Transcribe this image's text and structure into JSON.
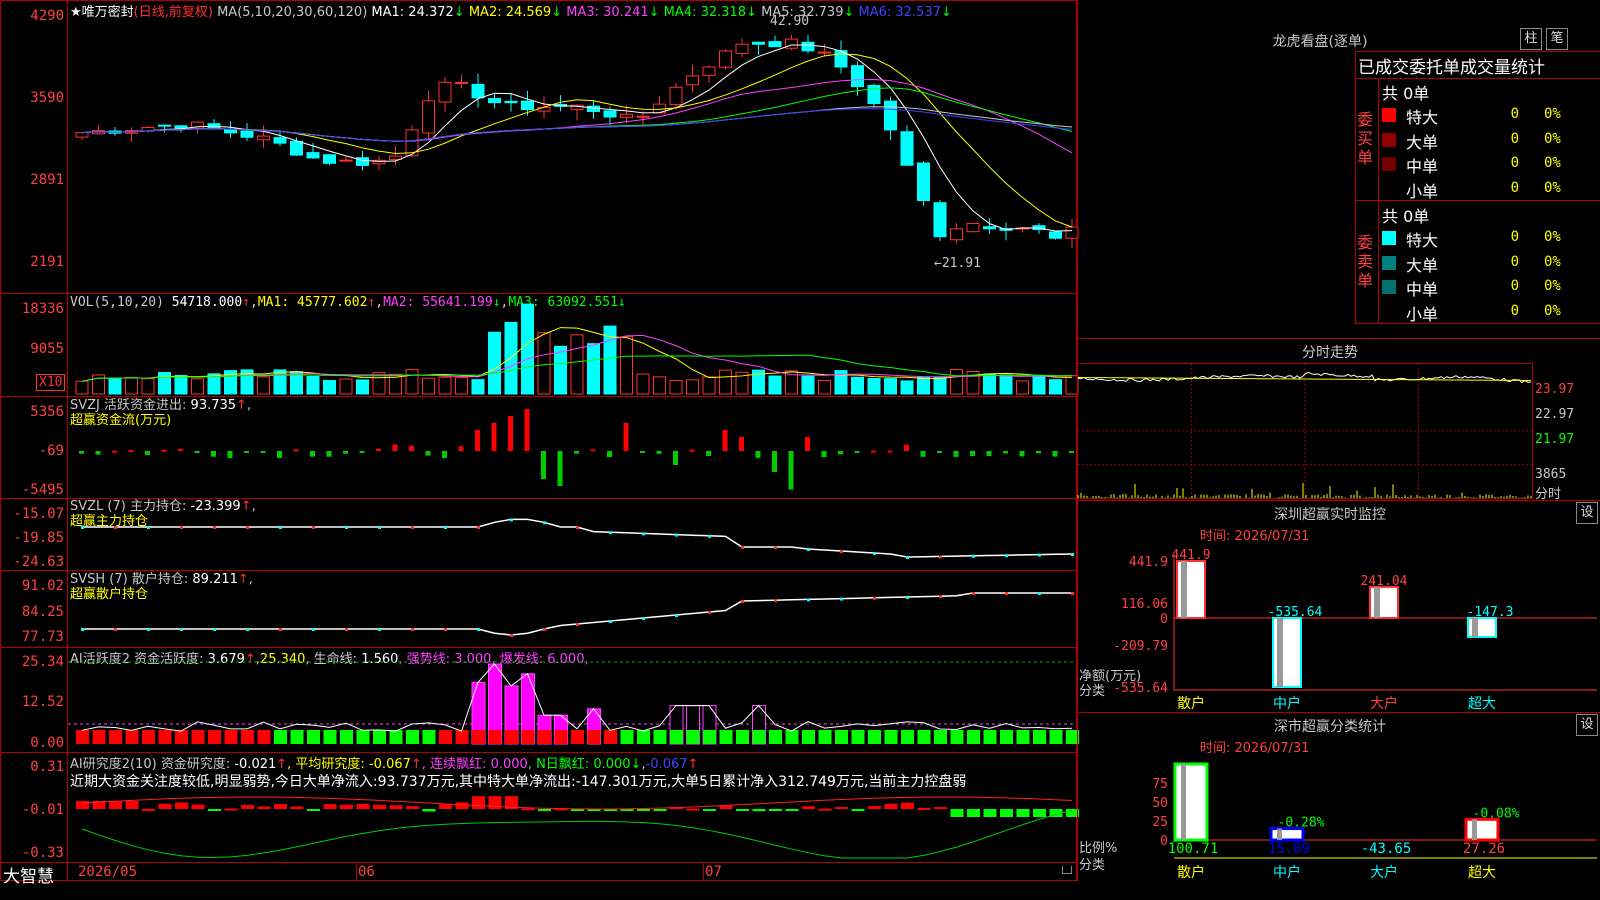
{
  "app": {
    "logo": "大智慧"
  },
  "main": {
    "star": "★",
    "stock_name": "唯万密封",
    "period": "(日线,前复权)",
    "ma_params": "MA(5,10,20,30,60,120)",
    "ma_items": [
      {
        "label": "MA1:",
        "value": "24.372",
        "arrow": "↓",
        "color": "#ffffff"
      },
      {
        "label": "MA2:",
        "value": "24.569",
        "arrow": "↓",
        "color": "#ffff00"
      },
      {
        "label": "MA3:",
        "value": "30.241",
        "arrow": "↓",
        "color": "#ff40ff"
      },
      {
        "label": "MA4:",
        "value": "32.318",
        "arrow": "↓",
        "color": "#00ff00"
      },
      {
        "label": "MA5:",
        "value": "32.739",
        "arrow": "↓",
        "color": "#c8c8c8"
      },
      {
        "label": "MA6:",
        "value": "32.537",
        "arrow": "↓",
        "color": "#4040ff"
      }
    ],
    "y_ticks": [
      "4290",
      "3590",
      "2891",
      "2191"
    ],
    "high_label": "42.90",
    "low_label": "←21.91"
  },
  "vol": {
    "params": "VOL(5,10,20)",
    "value": "54718.000",
    "arrow": "↑",
    "ma1": "MA1:",
    "ma1v": "45777.602",
    "ma1a": "↑",
    "ma2": "MA2:",
    "ma2v": "55641.199",
    "ma2a": "↓",
    "ma3": "MA3:",
    "ma3v": "63092.551",
    "ma3a": "↓",
    "y_ticks": [
      "18336",
      "9055"
    ],
    "unit": "X10"
  },
  "svzj": {
    "params": "SVZJ",
    "label": " 活跃资金进出:",
    "value": "93.735",
    "arrow": "↑",
    "comma": ",",
    "sub": "超赢资金流(万元)",
    "y_ticks": [
      "5356",
      "-69",
      "-5495"
    ]
  },
  "svzl": {
    "params": "SVZL (7)",
    "label": " 主力持仓:",
    "value": "-23.399",
    "arrow": "↑",
    "comma": ",",
    "sub": "超赢主力持仓",
    "y_ticks": [
      "-15.07",
      "-19.85",
      "-24.63"
    ]
  },
  "svsh": {
    "params": "SVSH (7)",
    "label": " 散户持仓:",
    "value": "89.211",
    "arrow": "↑",
    "comma": ",",
    "sub": "超赢散户持仓",
    "y_ticks": [
      "91.02",
      "84.25",
      "77.73"
    ]
  },
  "ai1": {
    "title": "AI活跃度2",
    "label": " 资金活跃度:",
    "value": "3.679",
    "a1": "↑",
    "v2": "25.340",
    "label3": ", 生命线:",
    "v3": "1.560",
    "label4": ", 强势线:",
    "v4": "3.000",
    "label5": ", 爆发线:",
    "v5": "6.000",
    "tail": ",",
    "y_ticks": [
      "25.34",
      "12.52",
      "0.00"
    ]
  },
  "ai2": {
    "title": "AI研究度2(10)",
    "label": " 资金研究度:",
    "value": "-0.021",
    "a1": "↑",
    "label2": ", 平均研究度:",
    "v2": "-0.067",
    "a2": "↑",
    "label3": ", 连续飘红:",
    "v3": "0.000",
    "label4": ", N日飘红:",
    "v4": "0.000",
    "a4": "↓",
    "v5": "-0.067",
    "a5": "↑",
    "desc": "近期大资金关注度较低,明显弱势,今日大单净流入:93.737万元,其中特大单净流出:-147.301万元,大单5日累计净入312.749万元,当前主力控盘弱",
    "y_ticks": [
      "0.31",
      "-0.01",
      "-0.33"
    ]
  },
  "xaxis": {
    "labels": [
      "2026/05",
      "06",
      "07"
    ]
  },
  "right": {
    "lhkp": {
      "title": "龙虎看盘(逐单)",
      "btn1": "柱",
      "btn2": "笔",
      "tab": "已成交委托单成交量统计",
      "buy": {
        "side": "委买单",
        "total": "共 0单",
        "rows": [
          {
            "name": "特大",
            "v": "0",
            "p": "0%",
            "color": "#ff0000"
          },
          {
            "name": "大单",
            "v": "0",
            "p": "0%",
            "color": "#900000"
          },
          {
            "name": "中单",
            "v": "0",
            "p": "0%",
            "color": "#700000"
          },
          {
            "name": "小单",
            "v": "0",
            "p": "0%",
            "color": ""
          }
        ]
      },
      "sell": {
        "side": "委卖单",
        "total": "共 0单",
        "rows": [
          {
            "name": "特大",
            "v": "0",
            "p": "0%",
            "color": "#00ffff"
          },
          {
            "name": "大单",
            "v": "0",
            "p": "0%",
            "color": "#008080"
          },
          {
            "name": "中单",
            "v": "0",
            "p": "0%",
            "color": "#007070"
          },
          {
            "name": "小单",
            "v": "0",
            "p": "0%",
            "color": ""
          }
        ]
      }
    },
    "fs": {
      "title": "分时走势",
      "y_ticks": [
        "23.97",
        "22.97",
        "21.97",
        "3865"
      ],
      "unit": "分时"
    },
    "rt": {
      "title": "深圳超赢实时监控",
      "btn": "设",
      "time": "时间: 2026/07/31",
      "y_ticks": [
        "441.9",
        "116.06",
        "0",
        "-209.79",
        "-535.64"
      ],
      "bars": [
        {
          "name": "散户",
          "value": 441.9,
          "label": "441.9"
        },
        {
          "name": "中户",
          "value": -535.64,
          "label": "-535.64"
        },
        {
          "name": "大户",
          "value": 241.04,
          "label": "241.04"
        },
        {
          "name": "超大",
          "value": -147.3,
          "label": "-147.3"
        }
      ],
      "ylabel1": "净额(万元)",
      "ylabel2": "分类"
    },
    "cls": {
      "title": "深市超赢分类统计",
      "btn": "设",
      "time": "时间: 2026/07/31",
      "y_ticks": [
        "75",
        "50",
        "25",
        "0"
      ],
      "bars": [
        {
          "name": "散户",
          "value": 100.71,
          "top": "",
          "bottom": "100.71"
        },
        {
          "name": "中户",
          "value": 15.09,
          "top": "-0.28%",
          "bottom": "15.09"
        },
        {
          "name": "大户",
          "value": -43.65,
          "top": "",
          "bottom": "-43.65"
        },
        {
          "name": "超大",
          "value": 27.26,
          "top": "-0.08%",
          "bottom": "27.26"
        }
      ],
      "ylabel1": "比例%",
      "ylabel2": "分类"
    }
  }
}
